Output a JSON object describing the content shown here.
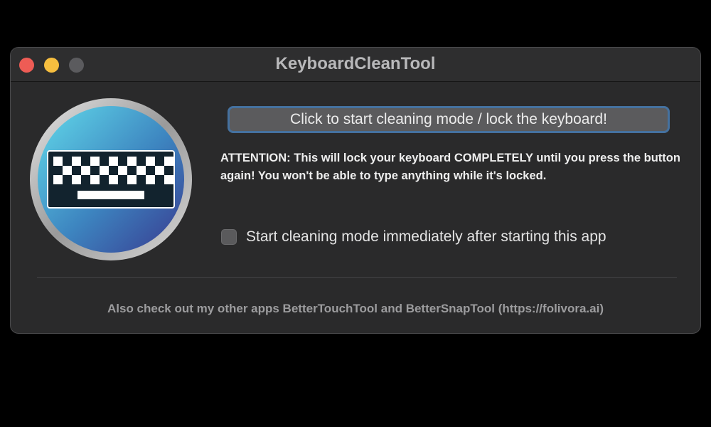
{
  "window": {
    "title": "KeyboardCleanTool"
  },
  "icon": {
    "name": "keyboard-clean-app-icon",
    "colors": {
      "gradient_light": "#55c4e0",
      "gradient_dark": "#3a4f9e",
      "ring": "#c9c9c9",
      "keyboard_body": "#12232e"
    }
  },
  "main": {
    "action_button_label": "Click to start cleaning mode / lock the keyboard!",
    "warning_text": "ATTENTION: This will lock your keyboard COMPLETELY until you press the button again! You won't be able to type anything while it's locked.",
    "checkbox": {
      "label": "Start cleaning mode immediately after starting this app",
      "checked": false
    }
  },
  "footer": {
    "text": "Also check out my other apps BetterTouchTool and BetterSnapTool (https://folivora.ai)"
  },
  "colors": {
    "window_bg": "#2a2a2b",
    "button_focus_ring": "#45719f",
    "close": "#ee5c55",
    "minimize": "#f6be3f",
    "zoom_disabled": "#5b5b5e"
  }
}
